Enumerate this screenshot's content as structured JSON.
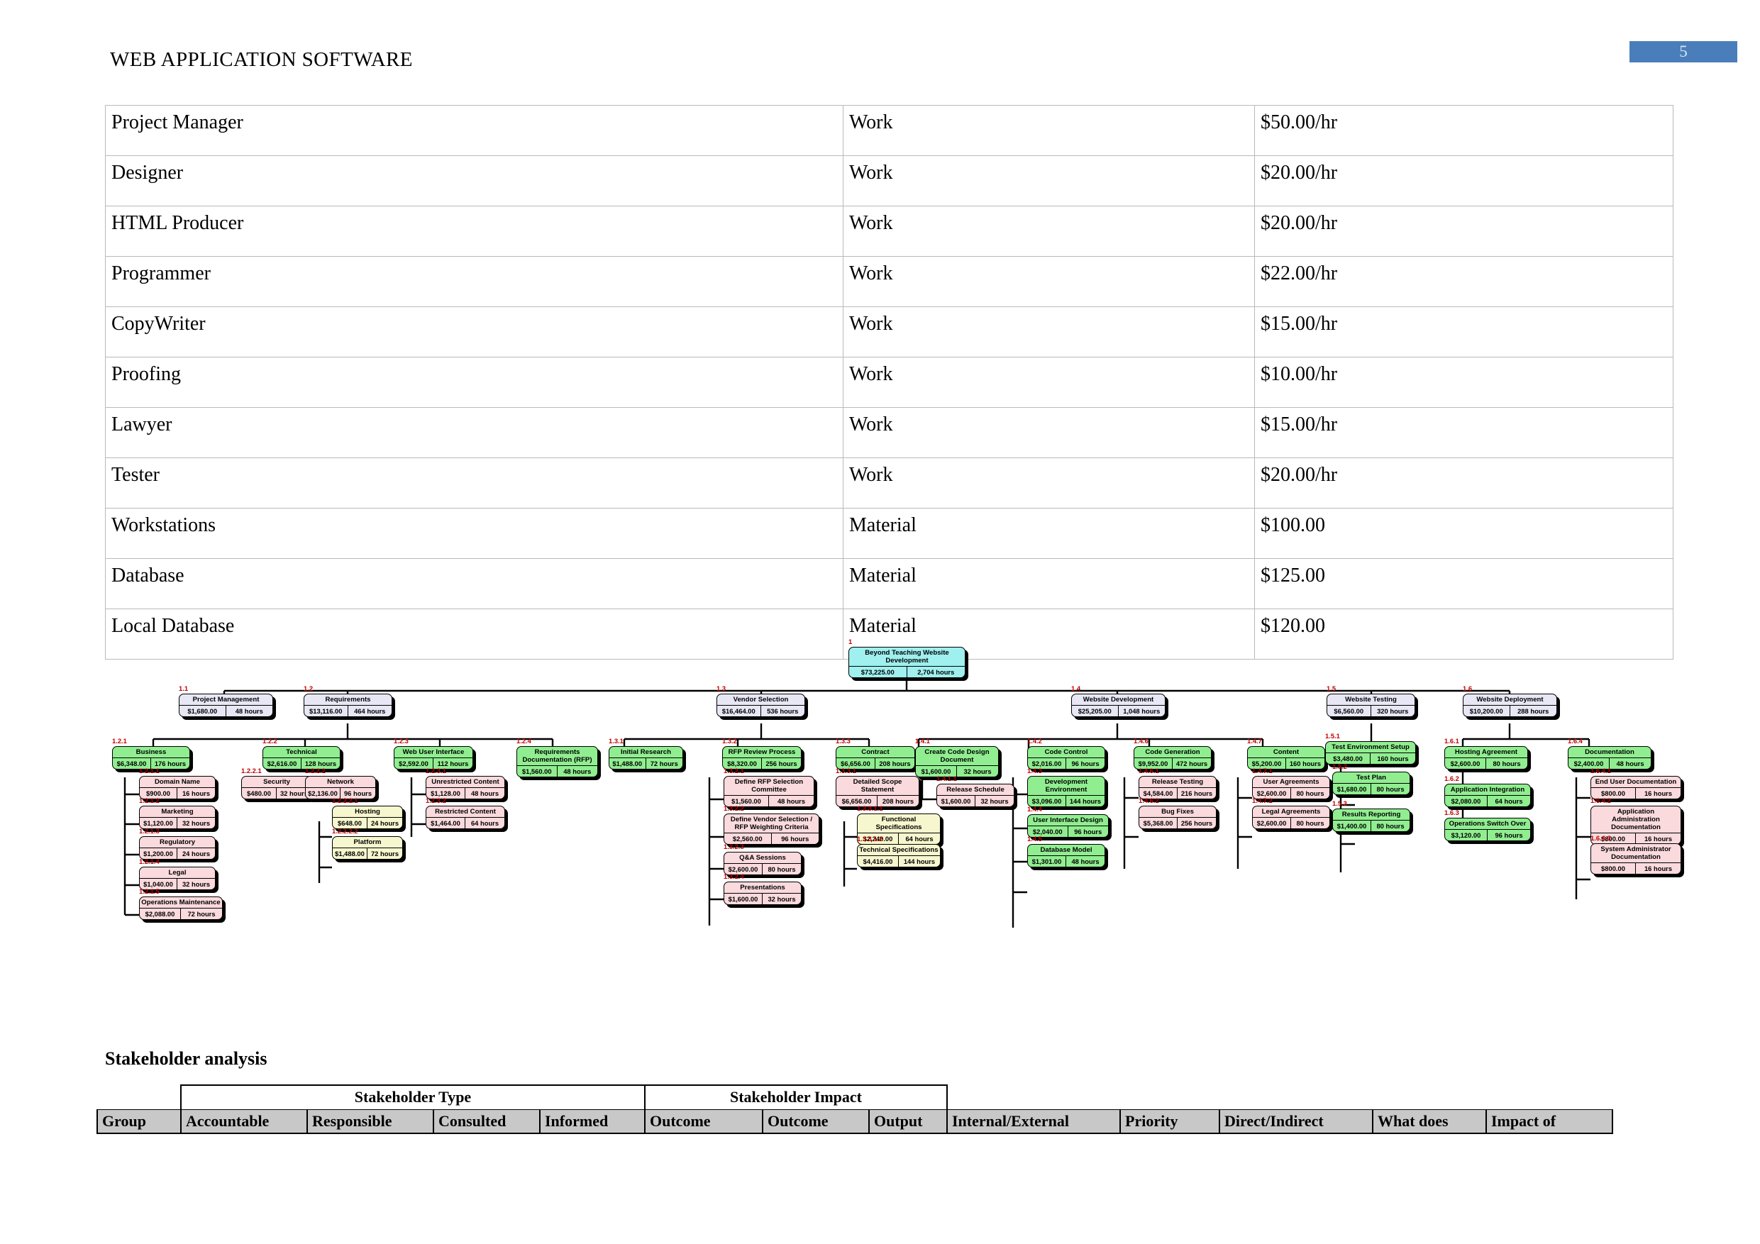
{
  "header": {
    "title": "WEB APPLICATION SOFTWARE",
    "page_number": "5"
  },
  "resource_table": {
    "rows": [
      {
        "name": "Project Manager",
        "type": "Work",
        "rate": "$50.00/hr"
      },
      {
        "name": "Designer",
        "type": "Work",
        "rate": "$20.00/hr"
      },
      {
        "name": "HTML Producer",
        "type": "Work",
        "rate": "$20.00/hr"
      },
      {
        "name": "Programmer",
        "type": "Work",
        "rate": "$22.00/hr"
      },
      {
        "name": "CopyWriter",
        "type": "Work",
        "rate": "$15.00/hr"
      },
      {
        "name": "Proofing",
        "type": "Work",
        "rate": "$10.00/hr"
      },
      {
        "name": "Lawyer",
        "type": "Work",
        "rate": "$15.00/hr"
      },
      {
        "name": "Tester",
        "type": "Work",
        "rate": "$20.00/hr"
      },
      {
        "name": "Workstations",
        "type": "Material",
        "rate": "$100.00"
      },
      {
        "name": "Database",
        "type": "Material",
        "rate": "$125.00"
      },
      {
        "name": "Local Database",
        "type": "Material",
        "rate": "$120.00"
      }
    ]
  },
  "wbs": {
    "colors": {
      "level1": "#9ff0ef",
      "level2": "#e7e7f5",
      "level3": "#90ee90",
      "level4": "#fadadd",
      "level5": "#f7f7cf",
      "id_label": "#c00000"
    },
    "nodes": [
      {
        "id": "1",
        "title": "Beyond Teaching Website Development",
        "cost": "$73,225.00",
        "hours": "2,704 hours",
        "level": 1
      },
      {
        "id": "1.1",
        "title": "Project Management",
        "cost": "$1,680.00",
        "hours": "48 hours",
        "level": 2
      },
      {
        "id": "1.2",
        "title": "Requirements",
        "cost": "$13,116.00",
        "hours": "464 hours",
        "level": 2
      },
      {
        "id": "1.3",
        "title": "Vendor Selection",
        "cost": "$16,464.00",
        "hours": "536 hours",
        "level": 2
      },
      {
        "id": "1.4",
        "title": "Website Development",
        "cost": "$25,205.00",
        "hours": "1,048 hours",
        "level": 2
      },
      {
        "id": "1.5",
        "title": "Website Testing",
        "cost": "$6,560.00",
        "hours": "320 hours",
        "level": 2
      },
      {
        "id": "1.6",
        "title": "Website Deployment",
        "cost": "$10,200.00",
        "hours": "288 hours",
        "level": 2
      },
      {
        "id": "1.2.1",
        "title": "Business",
        "cost": "$6,348.00",
        "hours": "176 hours",
        "level": 3
      },
      {
        "id": "1.2.1.1",
        "title": "Domain Name",
        "cost": "$900.00",
        "hours": "16 hours",
        "level": 4
      },
      {
        "id": "1.2.1.2",
        "title": "Marketing",
        "cost": "$1,120.00",
        "hours": "32 hours",
        "level": 4
      },
      {
        "id": "1.2.1.3",
        "title": "Regulatory",
        "cost": "$1,200.00",
        "hours": "24 hours",
        "level": 4
      },
      {
        "id": "1.2.1.4",
        "title": "Legal",
        "cost": "$1,040.00",
        "hours": "32 hours",
        "level": 4
      },
      {
        "id": "1.2.1.5",
        "title": "Operations Maintenance",
        "cost": "$2,088.00",
        "hours": "72 hours",
        "level": 4
      },
      {
        "id": "1.2.2",
        "title": "Technical",
        "cost": "$2,616.00",
        "hours": "128 hours",
        "level": 3
      },
      {
        "id": "1.2.2.1",
        "title": "Security",
        "cost": "$480.00",
        "hours": "32 hours",
        "level": 4
      },
      {
        "id": "1.2.2.2",
        "title": "Network",
        "cost": "$2,136.00",
        "hours": "96 hours",
        "level": 4
      },
      {
        "id": "1.2.2.2.1",
        "title": "Hosting",
        "cost": "$648.00",
        "hours": "24 hours",
        "level": 5
      },
      {
        "id": "1.2.2.2.2",
        "title": "Platform",
        "cost": "$1,488.00",
        "hours": "72 hours",
        "level": 5
      },
      {
        "id": "1.2.3",
        "title": "Web User Interface",
        "cost": "$2,592.00",
        "hours": "112 hours",
        "level": 3
      },
      {
        "id": "1.2.3.1",
        "title": "Unrestricted Content",
        "cost": "$1,128.00",
        "hours": "48 hours",
        "level": 4
      },
      {
        "id": "1.2.3.2",
        "title": "Restricted Content",
        "cost": "$1,464.00",
        "hours": "64 hours",
        "level": 4
      },
      {
        "id": "1.2.4",
        "title": "Requirements Documentation (RFP)",
        "cost": "$1,560.00",
        "hours": "48 hours",
        "level": 3
      },
      {
        "id": "1.3.1",
        "title": "Initial Research",
        "cost": "$1,488.00",
        "hours": "72 hours",
        "level": 3
      },
      {
        "id": "1.3.2",
        "title": "RFP Review Process",
        "cost": "$8,320.00",
        "hours": "256 hours",
        "level": 3
      },
      {
        "id": "1.3.2.1",
        "title": "Define RFP Selection Committee",
        "cost": "$1,560.00",
        "hours": "48 hours",
        "level": 4
      },
      {
        "id": "1.3.2.2",
        "title": "Define Vendor Selection / RFP Weighting Criteria",
        "cost": "$2,560.00",
        "hours": "96 hours",
        "level": 4
      },
      {
        "id": "1.3.2.3",
        "title": "Q&A Sessions",
        "cost": "$2,600.00",
        "hours": "80 hours",
        "level": 4
      },
      {
        "id": "1.3.2.4",
        "title": "Presentations",
        "cost": "$1,600.00",
        "hours": "32 hours",
        "level": 4
      },
      {
        "id": "1.3.3",
        "title": "Contract",
        "cost": "$6,656.00",
        "hours": "208 hours",
        "level": 3
      },
      {
        "id": "1.3.3.1",
        "title": "Detailed Scope Statement",
        "cost": "$6,656.00",
        "hours": "208 hours",
        "level": 4
      },
      {
        "id": "1.3.3.1.1",
        "title": "Functional Specifications",
        "cost": "$2,240.00",
        "hours": "64 hours",
        "level": 5
      },
      {
        "id": "1.3.3.1.2",
        "title": "Technical Specifications",
        "cost": "$4,416.00",
        "hours": "144 hours",
        "level": 5
      },
      {
        "id": "1.4.1",
        "title": "Create Code Design Document",
        "cost": "$1,600.00",
        "hours": "32 hours",
        "level": 3
      },
      {
        "id": "1.4.1.1",
        "title": "Release Schedule",
        "cost": "$1,600.00",
        "hours": "32 hours",
        "level": 4
      },
      {
        "id": "1.4.2",
        "title": "Code Control",
        "cost": "$2,016.00",
        "hours": "96 hours",
        "level": 3
      },
      {
        "id": "1.4.3",
        "title": "Development Environment",
        "cost": "$3,096.00",
        "hours": "144 hours",
        "level": 3
      },
      {
        "id": "1.4.4",
        "title": "User Interface Design",
        "cost": "$2,040.00",
        "hours": "96 hours",
        "level": 3
      },
      {
        "id": "1.4.5",
        "title": "Database Model",
        "cost": "$1,301.00",
        "hours": "48 hours",
        "level": 3
      },
      {
        "id": "1.4.6",
        "title": "Code Generation",
        "cost": "$9,952.00",
        "hours": "472 hours",
        "level": 3
      },
      {
        "id": "1.4.6.1",
        "title": "Release Testing",
        "cost": "$4,584.00",
        "hours": "216 hours",
        "level": 4
      },
      {
        "id": "1.4.6.2",
        "title": "Bug Fixes",
        "cost": "$5,368.00",
        "hours": "256 hours",
        "level": 4
      },
      {
        "id": "1.4.7",
        "title": "Content",
        "cost": "$5,200.00",
        "hours": "160 hours",
        "level": 3
      },
      {
        "id": "1.4.7.1",
        "title": "User Agreements",
        "cost": "$2,600.00",
        "hours": "80 hours",
        "level": 4
      },
      {
        "id": "1.4.7.2",
        "title": "Legal Agreements",
        "cost": "$2,600.00",
        "hours": "80 hours",
        "level": 4
      },
      {
        "id": "1.5.1",
        "title": "Test Environment Setup",
        "cost": "$3,480.00",
        "hours": "160 hours",
        "level": 3
      },
      {
        "id": "1.5.2",
        "title": "Test Plan",
        "cost": "$1,680.00",
        "hours": "80 hours",
        "level": 3
      },
      {
        "id": "1.5.3",
        "title": "Results Reporting",
        "cost": "$1,400.00",
        "hours": "80 hours",
        "level": 3
      },
      {
        "id": "1.6.1",
        "title": "Hosting Agreement",
        "cost": "$2,600.00",
        "hours": "80 hours",
        "level": 3
      },
      {
        "id": "1.6.2",
        "title": "Application Integration",
        "cost": "$2,080.00",
        "hours": "64 hours",
        "level": 3
      },
      {
        "id": "1.6.3",
        "title": "Operations Switch Over",
        "cost": "$3,120.00",
        "hours": "96 hours",
        "level": 3
      },
      {
        "id": "1.6.4",
        "title": "Documentation",
        "cost": "$2,400.00",
        "hours": "48 hours",
        "level": 3
      },
      {
        "id": "1.6.4.1",
        "title": "End User Documentation",
        "cost": "$800.00",
        "hours": "16 hours",
        "level": 4
      },
      {
        "id": "1.6.4.2",
        "title": "Application Administration Documentation",
        "cost": "$800.00",
        "hours": "16 hours",
        "level": 4
      },
      {
        "id": "1.6.4.3",
        "title": "System Administrator Documentation",
        "cost": "$800.00",
        "hours": "16 hours",
        "level": 4
      }
    ]
  },
  "stakeholder": {
    "heading": "Stakeholder analysis",
    "group_headers": [
      "Stakeholder Type",
      "Stakeholder Impact"
    ],
    "columns": [
      "Group",
      "Accountable",
      "Responsible",
      "Consulted",
      "Informed",
      "Outcome",
      "Outcome",
      "Output",
      "Internal/External",
      "Priority",
      "Direct/Indirect",
      "What does",
      "Impact of"
    ]
  }
}
